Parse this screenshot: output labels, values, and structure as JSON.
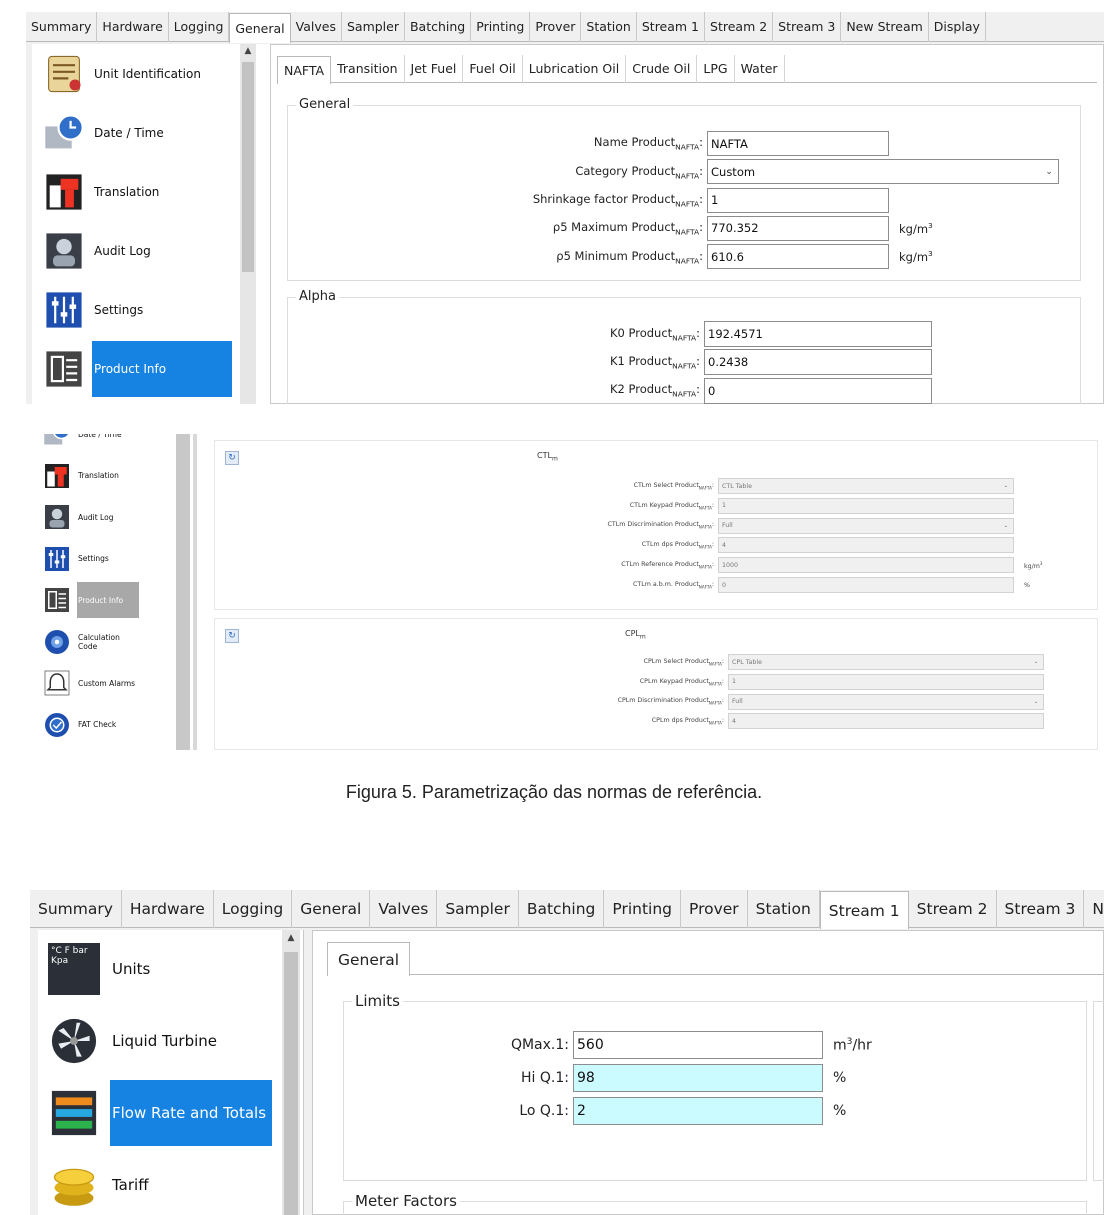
{
  "shot1": {
    "tabs": [
      "Summary",
      "Hardware",
      "Logging",
      "General",
      "Valves",
      "Sampler",
      "Batching",
      "Printing",
      "Prover",
      "Station",
      "Stream 1",
      "Stream 2",
      "Stream 3",
      "New Stream",
      "Display"
    ],
    "active_tab": "General",
    "sidebar": [
      {
        "label": "Unit Identification",
        "icon": "scroll-icon"
      },
      {
        "label": "Date / Time",
        "icon": "clock-icon"
      },
      {
        "label": "Translation",
        "icon": "translation-icon"
      },
      {
        "label": "Audit Log",
        "icon": "audit-log-icon"
      },
      {
        "label": "Settings",
        "icon": "sliders-icon"
      },
      {
        "label": "Product Info",
        "icon": "product-info-icon",
        "active": true
      }
    ],
    "inner_tabs": [
      "NAFTA",
      "Transition",
      "Jet Fuel",
      "Fuel Oil",
      "Lubrication Oil",
      "Crude Oil",
      "LPG",
      "Water"
    ],
    "general_group": {
      "title": "General",
      "fields": [
        {
          "label": "Name Product",
          "sub": "NAFTA",
          "value": "NAFTA",
          "unit": "",
          "unit_sup": ""
        },
        {
          "label": "Category Product",
          "sub": "NAFTA",
          "value": "Custom",
          "unit": "",
          "unit_sup": ""
        },
        {
          "label": "Shrinkage factor Product",
          "sub": "NAFTA",
          "value": "1",
          "unit": "",
          "unit_sup": ""
        },
        {
          "label": "ρ5 Maximum Product",
          "sub": "NAFTA",
          "value": "770.352",
          "unit": "kg/m",
          "unit_sup": "3"
        },
        {
          "label": "ρ5 Minimum Product",
          "sub": "NAFTA",
          "value": "610.6",
          "unit": "kg/m",
          "unit_sup": "3"
        }
      ]
    },
    "alpha_group": {
      "title": "Alpha",
      "fields": [
        {
          "label": "K0 Product",
          "sub": "NAFTA",
          "value": "192.4571"
        },
        {
          "label": "K1 Product",
          "sub": "NAFTA",
          "value": "0.2438"
        },
        {
          "label": "K2 Product",
          "sub": "NAFTA",
          "value": "0"
        }
      ]
    }
  },
  "shot2": {
    "sidebar": [
      {
        "label": "Date / Time",
        "icon": "clock-icon"
      },
      {
        "label": "Translation",
        "icon": "translation-icon"
      },
      {
        "label": "Audit Log",
        "icon": "audit-log-icon"
      },
      {
        "label": "Settings",
        "icon": "sliders-icon"
      },
      {
        "label": "Product Info",
        "icon": "product-info-icon",
        "active": true
      },
      {
        "label": "Calculation Code",
        "icon": "calculation-icon"
      },
      {
        "label": "Custom Alarms",
        "icon": "alarm-bell-icon"
      },
      {
        "label": "FAT Check",
        "icon": "check-icon"
      }
    ],
    "ctl_group": {
      "title": "CTL",
      "title_sub": "m",
      "fields": [
        {
          "label": "CTLm Select Product",
          "sub": "NAFTA",
          "value": "CTL Table",
          "unit": "",
          "unit_sup": ""
        },
        {
          "label": "CTLm Keypad Product",
          "sub": "NAFTA",
          "value": "1",
          "unit": "",
          "unit_sup": ""
        },
        {
          "label": "CTLm Discrimination Product",
          "sub": "NAFTA",
          "value": "Full",
          "unit": "",
          "unit_sup": ""
        },
        {
          "label": "CTLm dps Product",
          "sub": "NAFTA",
          "value": "4",
          "unit": "",
          "unit_sup": ""
        },
        {
          "label": "CTLm Reference Product",
          "sub": "NAFTA",
          "value": "1000",
          "unit": "kg/m",
          "unit_sup": "3"
        },
        {
          "label": "CTLm a.b.m. Product",
          "sub": "NAFTA",
          "value": "0",
          "unit": "%",
          "unit_sup": ""
        }
      ]
    },
    "cpl_group": {
      "title": "CPL",
      "title_sub": "m",
      "fields": [
        {
          "label": "CPLm Select Product",
          "sub": "NAFTA",
          "value": "CPL Table"
        },
        {
          "label": "CPLm Keypad Product",
          "sub": "NAFTA",
          "value": "1"
        },
        {
          "label": "CPLm Discrimination Product",
          "sub": "NAFTA",
          "value": "Full"
        },
        {
          "label": "CPLm dps Product",
          "sub": "NAFTA",
          "value": "4"
        }
      ]
    }
  },
  "caption": "Figura 5. Parametrização das normas de referência.",
  "shot3": {
    "tabs": [
      "Summary",
      "Hardware",
      "Logging",
      "General",
      "Valves",
      "Sampler",
      "Batching",
      "Printing",
      "Prover",
      "Station",
      "Stream 1",
      "Stream 2",
      "Stream 3",
      "New Strea"
    ],
    "active_tab": "Stream 1",
    "sidebar": [
      {
        "label": "Units",
        "icon": "units-icon"
      },
      {
        "label": "Liquid Turbine",
        "icon": "turbine-icon"
      },
      {
        "label": "Flow Rate and Totals",
        "icon": "flow-rate-icon",
        "active": true
      },
      {
        "label": "Tariff",
        "icon": "coins-icon"
      }
    ],
    "units_icon_text": "°C F bar Kpa",
    "inner_tabs": [
      "General"
    ],
    "limits_group": {
      "title": "Limits",
      "fields": [
        {
          "label": "QMax.1:",
          "value": "560",
          "unit": "m",
          "unit_sup": "3",
          "unit_tail": "/hr"
        },
        {
          "label": "Hi Q.1:",
          "value": "98",
          "unit": "%",
          "unit_sup": "",
          "unit_tail": ""
        },
        {
          "label": "Lo Q.1:",
          "value": "2",
          "unit": "%",
          "unit_sup": "",
          "unit_tail": ""
        }
      ]
    },
    "meter_group": {
      "title": "Meter Factors"
    }
  },
  "colors": {
    "selected_blue": "#1683e3",
    "selected_gray": "#a8a8a8",
    "input_cyan": "#ccfbff"
  }
}
